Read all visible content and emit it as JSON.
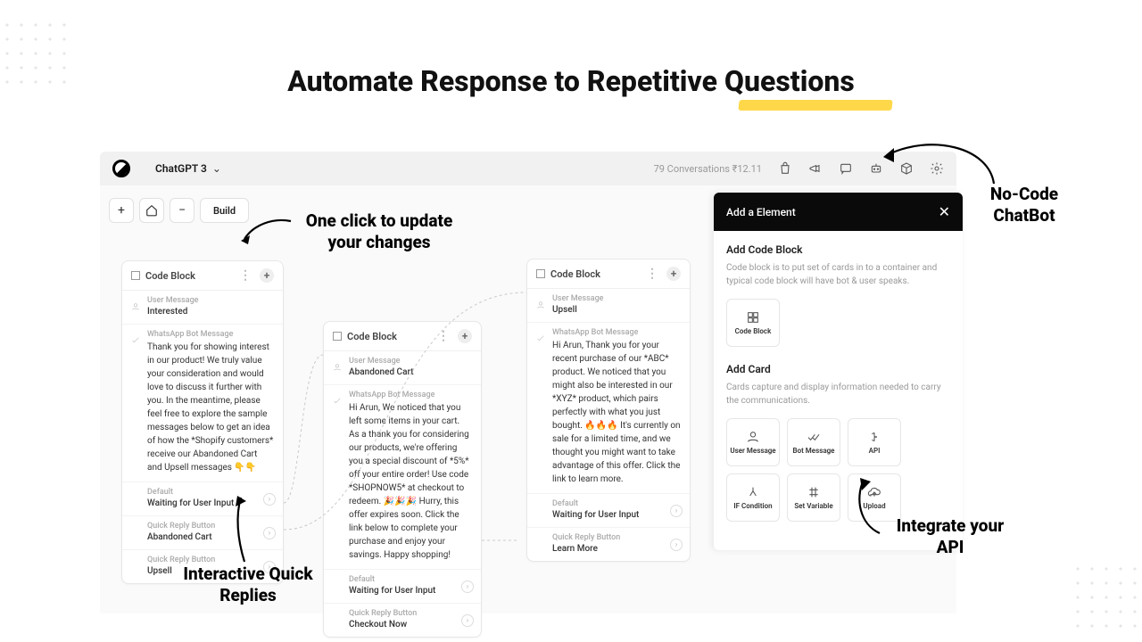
{
  "headline": "Automate Response to Repetitive Questions",
  "appbar": {
    "model_name": "ChatGPT 3",
    "meta": "79 Conversations  ₹12.11"
  },
  "toolbar": {
    "build_label": "Build"
  },
  "annotations": {
    "one_click": "One click to update your changes",
    "quick_replies": "Interactive Quick Replies",
    "no_code": "No-Code ChatBot",
    "integrate": "Integrate your API"
  },
  "block1": {
    "title": "Code Block",
    "user_msg_label": "User Message",
    "user_msg_val": "Interested",
    "bot_label": "WhatsApp Bot Message",
    "bot_msg": "Thank you for showing interest in our product! We truly value your consideration and would love to discuss it further with you. In the meantime, please feel free to explore the sample messages below to get an idea of how the *Shopify customers* receive our Abandoned Cart and Upsell messages 👇👇",
    "default_label": "Default",
    "default_val": "Waiting for User Input",
    "qr1_label": "Quick Reply Button",
    "qr1_val": "Abandoned Cart",
    "qr2_label": "Quick Reply Button",
    "qr2_val": "Upsell"
  },
  "block2": {
    "title": "Code Block",
    "user_msg_label": "User Message",
    "user_msg_val": "Abandoned Cart",
    "bot_label": "WhatsApp Bot Message",
    "bot_msg": "Hi Arun, We noticed that you left some items in your cart. As a thank you for considering our products, we're offering you a special discount of *5%* off your entire order! Use code *SHOPNOW5* at checkout to redeem. 🎉🎉🎉 Hurry, this offer expires soon. Click the link below to complete your purchase and enjoy your savings. Happy shopping!",
    "default_label": "Default",
    "default_val": "Waiting for User Input",
    "qr1_label": "Quick Reply Button",
    "qr1_val": "Checkout Now"
  },
  "block3": {
    "title": "Code Block",
    "user_msg_label": "User Message",
    "user_msg_val": "Upsell",
    "bot_label": "WhatsApp Bot Message",
    "bot_msg": "Hi Arun, Thank you for your recent purchase of our *ABC* product. We noticed that you might also be interested in our *XYZ* product, which pairs perfectly with what you just bought. 🔥🔥🔥 It's currently on sale for a limited time, and we thought you might want to take advantage of this offer. Click the link to learn more.",
    "default_label": "Default",
    "default_val": "Waiting for User Input",
    "qr1_label": "Quick Reply Button",
    "qr1_val": "Learn More"
  },
  "panel": {
    "title": "Add a Element",
    "section1_title": "Add Code Block",
    "section1_desc": "Code block is to put set of cards in to a container and typical code block will have bot & user speaks.",
    "opt_code_block": "Code Block",
    "section2_title": "Add Card",
    "section2_desc": "Cards capture and display information needed to carry the communications.",
    "opt_user_message": "User Message",
    "opt_bot_message": "Bot Message",
    "opt_api": "API",
    "opt_if": "IF Condition",
    "opt_set_var": "Set Variable",
    "opt_upload": "Upload"
  }
}
